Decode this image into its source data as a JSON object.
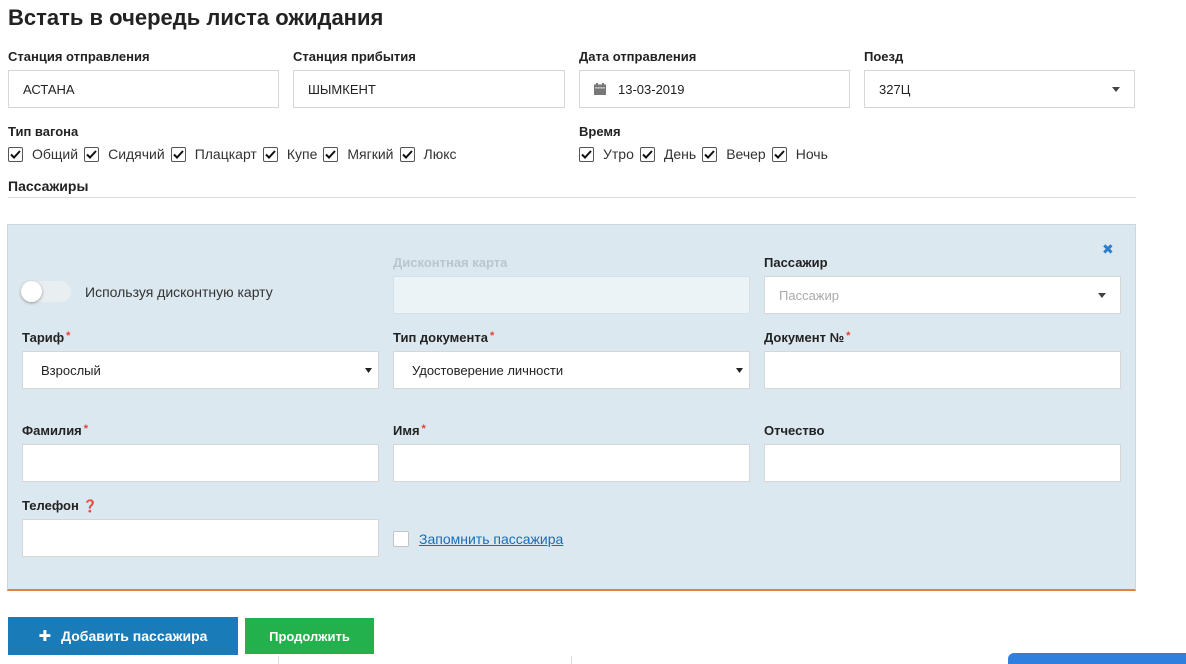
{
  "page_title": "Встать в очередь листа ожидания",
  "route": {
    "departure": {
      "label": "Станция отправления",
      "value": "АСТАНА"
    },
    "arrival": {
      "label": "Станция прибытия",
      "value": "ШЫМКЕНТ"
    },
    "date": {
      "label": "Дата отправления",
      "value": "13-03-2019"
    },
    "train": {
      "label": "Поезд",
      "value": "327Ц"
    }
  },
  "car_type": {
    "label": "Тип вагона",
    "options": [
      "Общий",
      "Сидячий",
      "Плацкарт",
      "Купе",
      "Мягкий",
      "Люкс"
    ]
  },
  "time": {
    "label": "Время",
    "options": [
      "Утро",
      "День",
      "Вечер",
      "Ночь"
    ]
  },
  "passengers_section": "Пассажиры",
  "passenger_form": {
    "discount_toggle": "Используя дисконтную карту",
    "discount_card": {
      "label": "Дисконтная карта",
      "value": ""
    },
    "passenger": {
      "label": "Пассажир",
      "placeholder": "Пассажир"
    },
    "tariff": {
      "label": "Тариф",
      "value": "Взрослый"
    },
    "doc_type": {
      "label": "Тип документа",
      "value": "Удостоверение личности"
    },
    "doc_number": {
      "label": "Документ №",
      "value": ""
    },
    "last_name": {
      "label": "Фамилия",
      "value": ""
    },
    "first_name": {
      "label": "Имя",
      "value": ""
    },
    "patronymic": {
      "label": "Отчество",
      "value": ""
    },
    "phone": {
      "label": "Телефон",
      "value": ""
    },
    "remember": "Запомнить пассажира",
    "required_mark": "*",
    "help_mark": "❓",
    "close_mark": "✖"
  },
  "actions": {
    "add_passenger": "Добавить пассажира",
    "add_icon": "✚",
    "continue": "Продолжить"
  },
  "colors": {
    "primary_button": "#1a7bb9",
    "success_button": "#22b14c",
    "panel_bg": "#dce8ef",
    "panel_border_bottom": "#e8823a",
    "link": "#1a6db5",
    "required": "#e2412f"
  }
}
